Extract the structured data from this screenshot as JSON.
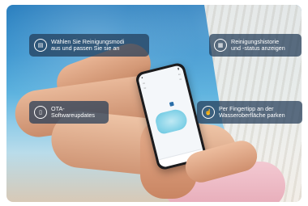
{
  "callouts": [
    {
      "icon": "robot-icon",
      "text": "Wählen Sie Reinigungsmodi\naus und passen Sie sie an"
    },
    {
      "icon": "history-icon",
      "text": "Reinigungshistorie\nund -status anzeigen"
    },
    {
      "icon": "update-icon",
      "text": "OTA-\nSoftwareupdates"
    },
    {
      "icon": "touch-icon",
      "text": "Per Fingertipp an der\nWasseroberfläche parken"
    }
  ],
  "colors": {
    "callout_bg": "#213a56",
    "water": "#3b95cf"
  }
}
